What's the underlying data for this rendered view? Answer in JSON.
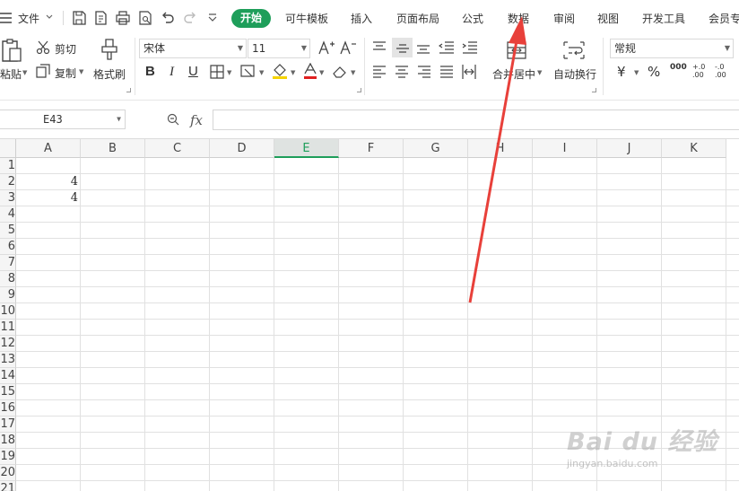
{
  "menubar": {
    "file_label": "文件",
    "tabs": [
      "开始",
      "可牛模板",
      "插入",
      "页面布局",
      "公式",
      "数据",
      "审阅",
      "视图",
      "开发工具",
      "会员专"
    ]
  },
  "ribbon": {
    "paste_label": "粘贴",
    "cut_label": "剪切",
    "copy_label": "复制",
    "format_painter_label": "格式刷",
    "font_name": "宋体",
    "font_size": "11",
    "bold": "B",
    "italic": "I",
    "underline": "U",
    "merge_label": "合并居中",
    "wrap_label": "自动换行",
    "number_format": "常规",
    "currency_symbol": "¥",
    "percent_symbol": "%",
    "thousands_symbol": "000",
    "inc_decimal": "+.0 .00",
    "dec_decimal": "-.0 .00"
  },
  "formula_bar": {
    "cell_ref": "E43",
    "fx_label": "fx",
    "formula": ""
  },
  "grid": {
    "columns": [
      "A",
      "B",
      "C",
      "D",
      "E",
      "F",
      "G",
      "H",
      "I",
      "J",
      "K"
    ],
    "selected_column": "E",
    "rows": [
      "1",
      "2",
      "3",
      "4",
      "5",
      "6",
      "7",
      "8",
      "9",
      "10",
      "11",
      "12",
      "13",
      "14",
      "15",
      "16",
      "17",
      "18",
      "19",
      "20",
      "21"
    ],
    "cells": [
      {
        "ref": "A2",
        "value": "4"
      },
      {
        "ref": "A3",
        "value": "4"
      }
    ]
  },
  "annotation": {
    "arrow_color": "#e8403a"
  },
  "watermark": {
    "brand": "Bai du 经验",
    "url": "jingyan.baidu.com"
  },
  "colors": {
    "accent": "#1e9e5a",
    "header_bg": "#f5f5f5"
  }
}
